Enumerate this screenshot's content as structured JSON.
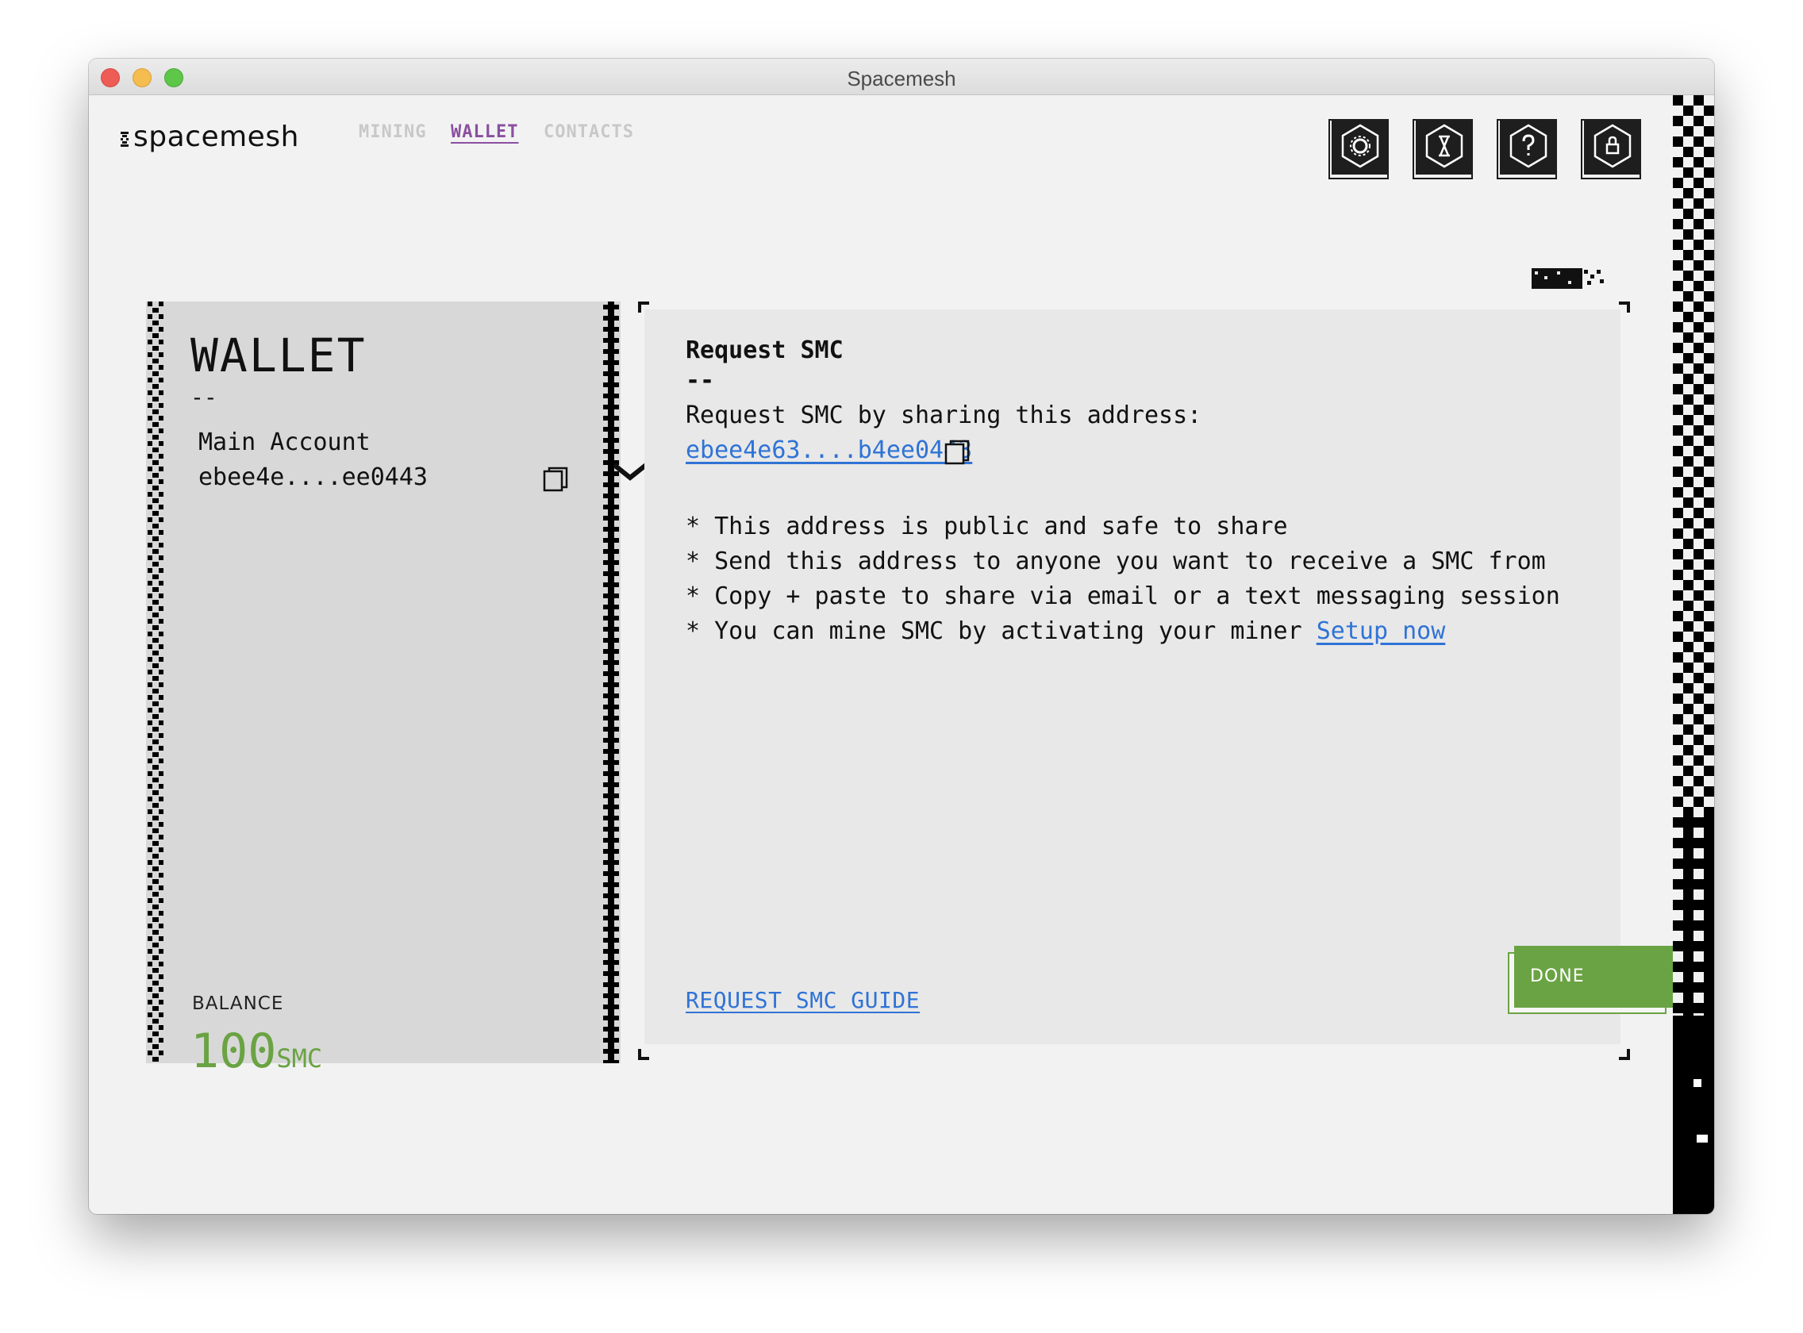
{
  "window": {
    "title": "Spacemesh"
  },
  "header": {
    "logo_text": "spacemesh",
    "nav": [
      {
        "label": "MINING",
        "active": false
      },
      {
        "label": "WALLET",
        "active": true
      },
      {
        "label": "CONTACTS",
        "active": false
      }
    ],
    "icon_buttons": [
      "settings-icon",
      "hourglass-icon",
      "help-icon",
      "lock-icon"
    ]
  },
  "wallet_panel": {
    "title": "WALLET",
    "divider": "--",
    "account_name": "Main Account",
    "account_address": "ebee4e....ee0443",
    "balance_label": "BALANCE",
    "balance_value": "100",
    "balance_unit": "SMC"
  },
  "request_panel": {
    "title": "Request SMC",
    "divider": "--",
    "intro": "Request SMC by sharing this address:",
    "address": "ebee4e63....b4ee0443",
    "bullets": [
      "* This address is public and safe to share",
      "* Send this address to anyone you want to receive a SMC from",
      "* Copy + paste to share via email or a text messaging session",
      "* You can mine SMC by activating your miner "
    ],
    "setup_link": "Setup now",
    "guide_link": "REQUEST SMC GUIDE",
    "done_label": "DONE"
  },
  "colors": {
    "accent_green": "#6aa343",
    "nav_active": "#8a4fa0",
    "link_blue": "#2f73d6",
    "panel_gray": "#d8d8d8"
  }
}
